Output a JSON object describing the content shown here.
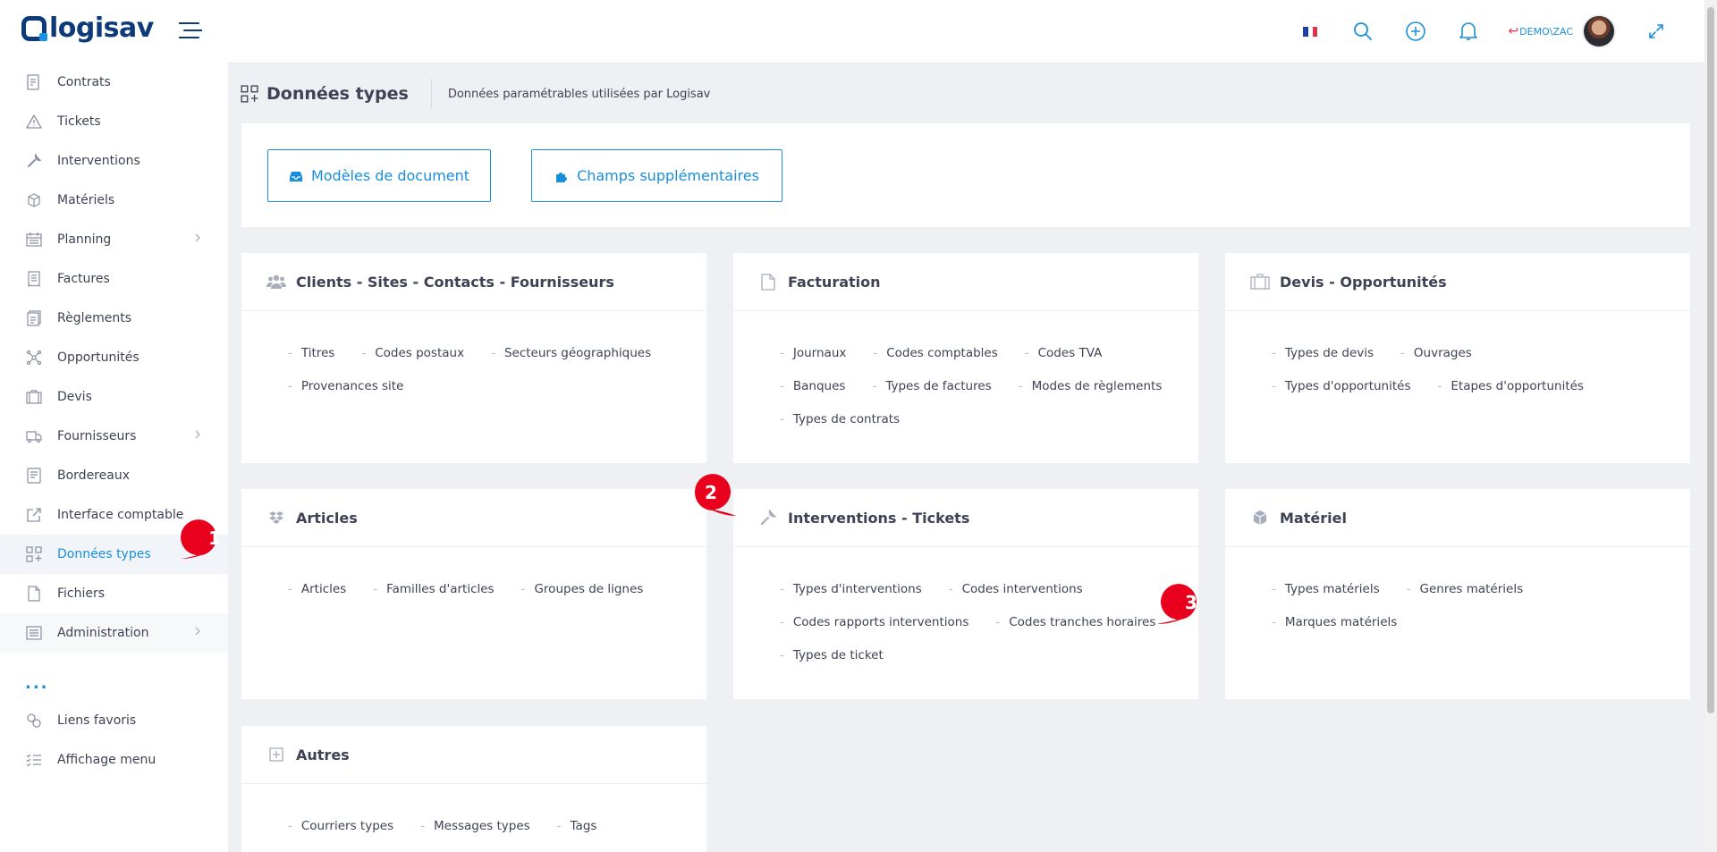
{
  "app": {
    "logo_text": "logisav",
    "user_context": "DEMO\\ZAC"
  },
  "colors": {
    "accent": "#1a8fd9",
    "brand": "#0d3b7a",
    "marker": "#e8001c"
  },
  "sidebar": {
    "items": [
      {
        "label": "Contrats",
        "icon": "contract-icon"
      },
      {
        "label": "Tickets",
        "icon": "warning-triangle-icon"
      },
      {
        "label": "Interventions",
        "icon": "wrench-icon"
      },
      {
        "label": "Matériels",
        "icon": "cube-icon"
      },
      {
        "label": "Planning",
        "icon": "calendar-icon"
      },
      {
        "label": "Factures",
        "icon": "invoice-icon"
      },
      {
        "label": "Règlements",
        "icon": "payment-icon"
      },
      {
        "label": "Opportunités",
        "icon": "network-icon"
      },
      {
        "label": "Devis",
        "icon": "briefcase-icon"
      },
      {
        "label": "Fournisseurs",
        "icon": "truck-icon"
      },
      {
        "label": "Bordereaux",
        "icon": "slip-icon"
      },
      {
        "label": "Interface comptable",
        "icon": "external-link-icon"
      },
      {
        "label": "Données types",
        "icon": "grid-plus-icon"
      },
      {
        "label": "Fichiers",
        "icon": "file-icon"
      },
      {
        "label": "Administration",
        "icon": "settings-list-icon"
      }
    ],
    "more": "...",
    "bottom": [
      {
        "label": "Liens favoris",
        "icon": "link-icon"
      },
      {
        "label": "Affichage menu",
        "icon": "checklist-icon"
      }
    ]
  },
  "header": {
    "title": "Données types",
    "description": "Données paramétrables utilisées par Logisav"
  },
  "buttons": {
    "models": "Modèles de document",
    "fields": "Champs supplémentaires"
  },
  "panels": {
    "clients": {
      "title": "Clients - Sites - Contacts - Fournisseurs",
      "links": [
        "Titres",
        "Codes postaux",
        "Secteurs géographiques",
        "Provenances site"
      ]
    },
    "facturation": {
      "title": "Facturation",
      "links": [
        "Journaux",
        "Codes comptables",
        "Codes TVA",
        "Banques",
        "Types de factures",
        "Modes de règlements",
        "Types de contrats"
      ]
    },
    "devis": {
      "title": "Devis - Opportunités",
      "links": [
        "Types de devis",
        "Ouvrages",
        "Types d'opportunités",
        "Etapes d'opportunités"
      ]
    },
    "articles": {
      "title": "Articles",
      "links": [
        "Articles",
        "Familles d'articles",
        "Groupes de lignes"
      ]
    },
    "interventions": {
      "title": "Interventions - Tickets",
      "links": [
        "Types d'interventions",
        "Codes interventions",
        "Codes rapports interventions",
        "Codes tranches horaires",
        "Types de ticket"
      ]
    },
    "materiel": {
      "title": "Matériel",
      "links": [
        "Types matériels",
        "Genres matériels",
        "Marques matériels"
      ]
    },
    "autres": {
      "title": "Autres",
      "links": [
        "Courriers types",
        "Messages types",
        "Tags"
      ]
    }
  },
  "markers": [
    "1",
    "2",
    "3"
  ]
}
